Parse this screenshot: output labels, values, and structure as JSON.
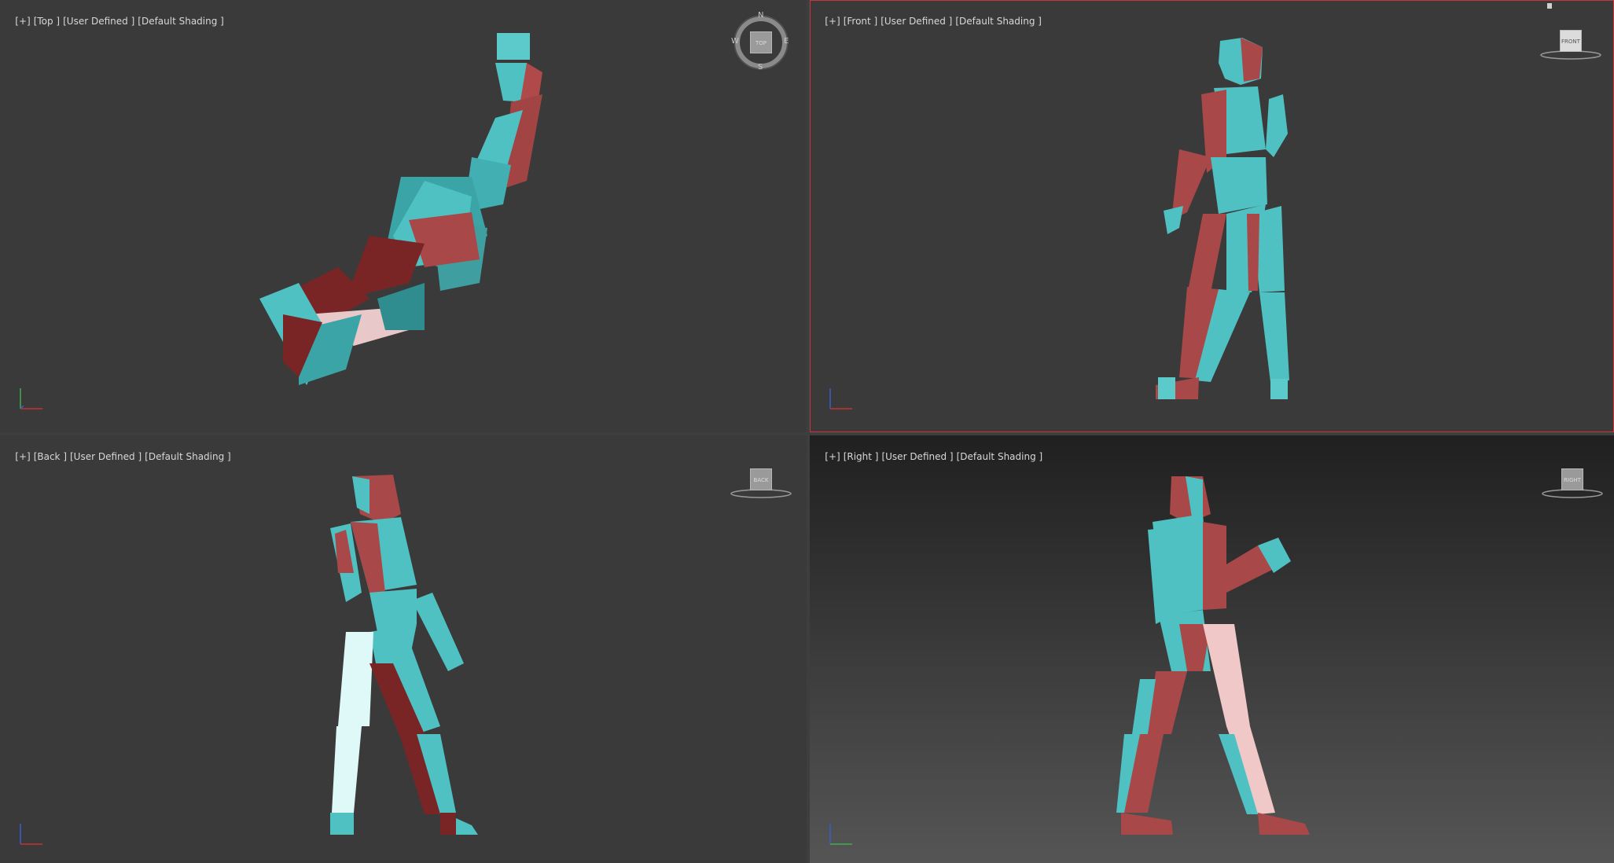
{
  "viewports": {
    "top": {
      "plus": "[+]",
      "view": "[Top ]",
      "preset": "[User Defined ]",
      "shading": "[Default Shading ]",
      "cube_label": "TOP"
    },
    "front": {
      "plus": "[+]",
      "view": "[Front ]",
      "preset": "[User Defined ]",
      "shading": "[Default Shading ]",
      "cube_label": "FRONT"
    },
    "back": {
      "plus": "[+]",
      "view": "[Back ]",
      "preset": "[User Defined ]",
      "shading": "[Default Shading ]",
      "cube_label": "BACK"
    },
    "right": {
      "plus": "[+]",
      "view": "[Right ]",
      "preset": "[User Defined ]",
      "shading": "[Default Shading ]",
      "cube_label": "RIGHT"
    }
  },
  "compass": {
    "n": "N",
    "s": "S",
    "e": "E",
    "w": "W"
  },
  "colors": {
    "viewport_bg": "#3a3a3a",
    "teal": "#4fc1c2",
    "maroon": "#a04444",
    "active_border": "#c8353a"
  }
}
